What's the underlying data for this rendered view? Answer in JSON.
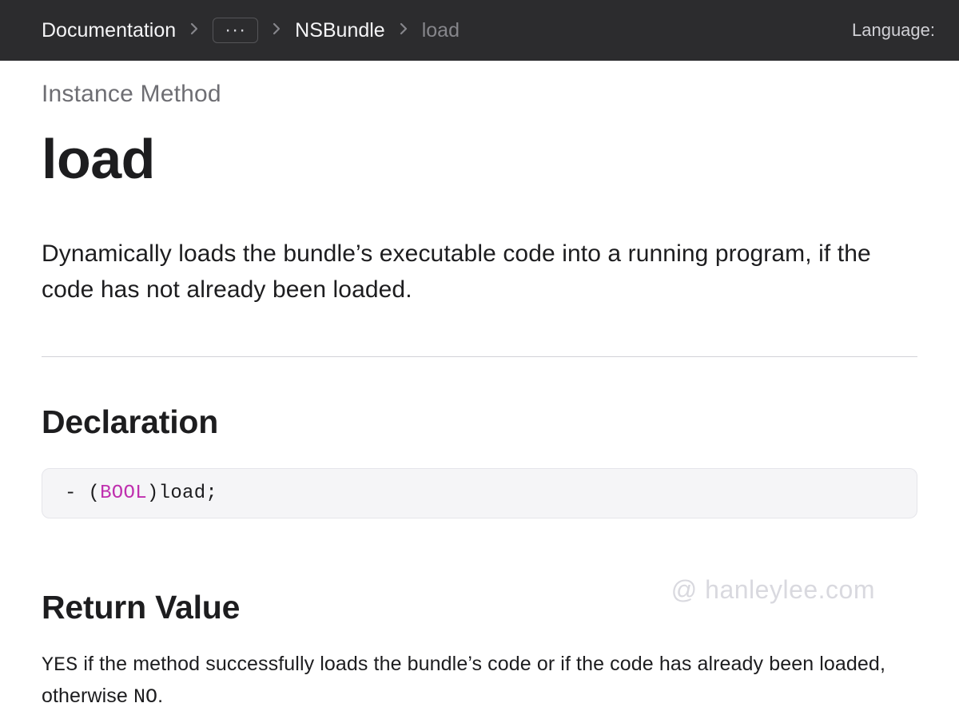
{
  "breadcrumb": {
    "root": "Documentation",
    "ellipsis": "···",
    "class_name": "NSBundle",
    "current": "load"
  },
  "language_label": "Language:",
  "page": {
    "eyebrow": "Instance Method",
    "title": "load",
    "summary": "Dynamically loads the bundle’s executable code into a running program, if the code has not already been loaded."
  },
  "declaration": {
    "heading": "Declaration",
    "code_prefix": "- (",
    "code_keyword": "BOOL",
    "code_suffix": ")load;"
  },
  "return_value": {
    "heading": "Return Value",
    "text_before_yes": "",
    "yes_token": "YES",
    "text_middle": " if the method successfully loads the bundle’s code or if the code has already been loaded, otherwise ",
    "no_token": "NO",
    "text_after_no": "."
  },
  "watermark": "@ hanleylee.com"
}
